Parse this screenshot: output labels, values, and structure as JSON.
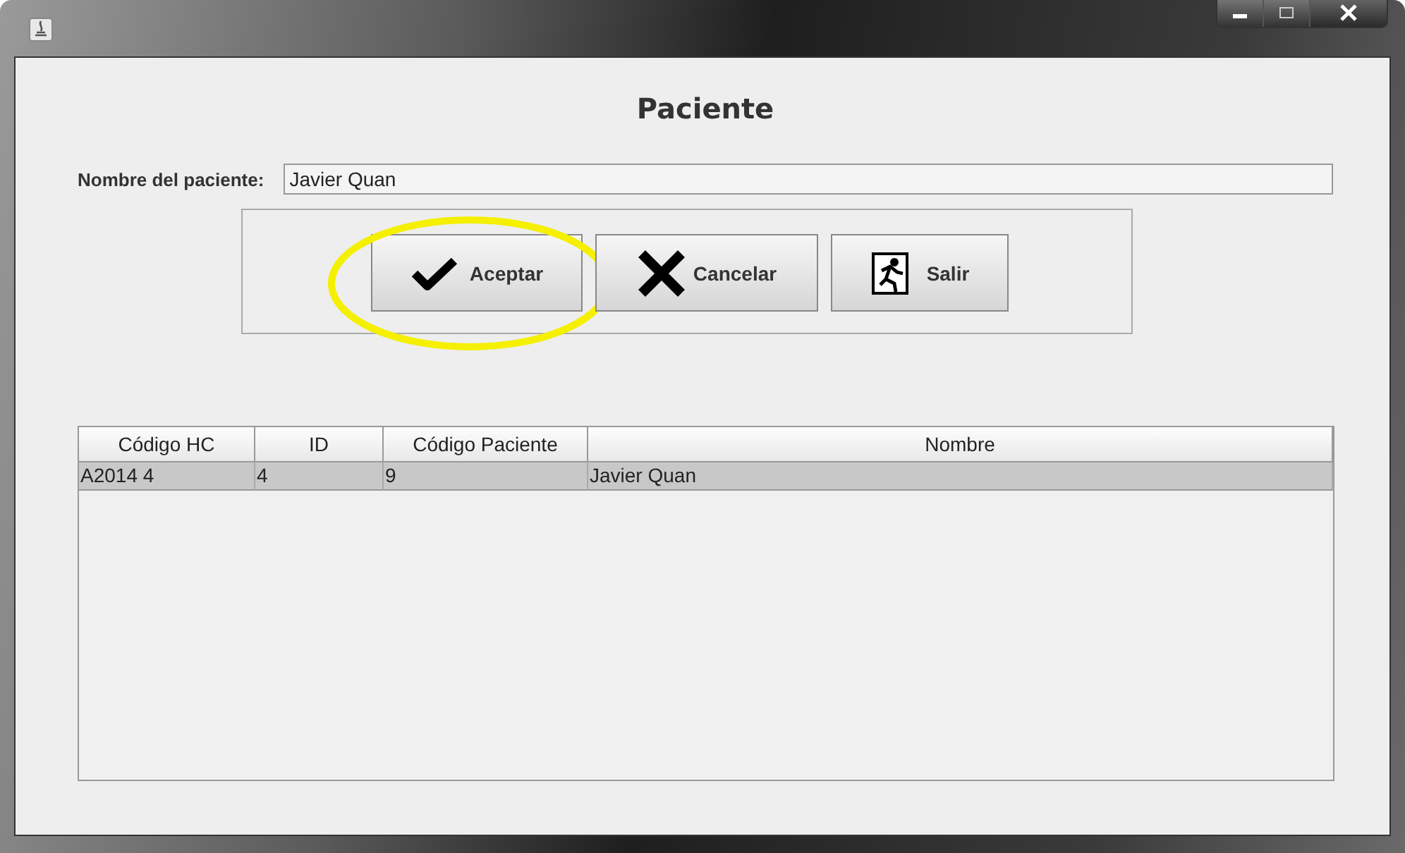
{
  "window": {
    "title": "Paciente"
  },
  "form": {
    "label": "Nombre del paciente:",
    "value": "Javier Quan"
  },
  "buttons": [
    {
      "kind": "check",
      "label": "Aceptar",
      "highlighted": true
    },
    {
      "kind": "cross",
      "label": "Cancelar",
      "highlighted": false
    },
    {
      "kind": "exit",
      "label": "Salir",
      "highlighted": false
    }
  ],
  "table": {
    "columns": [
      "Código HC",
      "ID",
      "Código Paciente",
      "Nombre"
    ],
    "rows": [
      {
        "cells": [
          "A2014 4",
          "4",
          "9",
          "Javier Quan"
        ],
        "selected": true
      }
    ]
  }
}
